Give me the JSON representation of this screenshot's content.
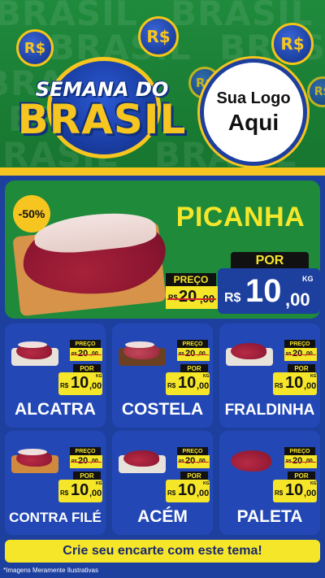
{
  "header": {
    "bg_word": "BRASIL",
    "currency_coin": "R$",
    "badge_line1": "SEMANA DO",
    "badge_line2": "BRASIL",
    "logo_line1": "Sua Logo",
    "logo_line2": "Aqui"
  },
  "feature": {
    "discount": "-50%",
    "name": "PICANHA",
    "old_label": "PREÇO",
    "old_currency": "R$",
    "old_int": "20",
    "old_dec": ",00",
    "new_label": "POR",
    "new_currency": "R$",
    "new_int": "10",
    "new_dec": ",00",
    "unit": "KG"
  },
  "cards": [
    {
      "name": "ALCATRA",
      "old_label": "PREÇO",
      "old_currency": "R$",
      "old_int": "20",
      "old_dec": ",00",
      "new_label": "POR",
      "new_currency": "R$",
      "new_int": "10",
      "new_dec": ",00",
      "unit": "KG"
    },
    {
      "name": "COSTELA",
      "old_label": "PREÇO",
      "old_currency": "R$",
      "old_int": "20",
      "old_dec": ",00",
      "new_label": "POR",
      "new_currency": "R$",
      "new_int": "10",
      "new_dec": ",00",
      "unit": "KG"
    },
    {
      "name": "FRALDINHA",
      "old_label": "PREÇO",
      "old_currency": "R$",
      "old_int": "20",
      "old_dec": ",00",
      "new_label": "POR",
      "new_currency": "R$",
      "new_int": "10",
      "new_dec": ",00",
      "unit": "KG"
    },
    {
      "name": "CONTRA FILÉ",
      "old_label": "PREÇO",
      "old_currency": "R$",
      "old_int": "20",
      "old_dec": ",00",
      "new_label": "POR",
      "new_currency": "R$",
      "new_int": "10",
      "new_dec": ",00",
      "unit": "KG"
    },
    {
      "name": "ACÉM",
      "old_label": "PREÇO",
      "old_currency": "R$",
      "old_int": "20",
      "old_dec": ",00",
      "new_label": "POR",
      "new_currency": "R$",
      "new_int": "10",
      "new_dec": ",00",
      "unit": "KG"
    },
    {
      "name": "PALETA",
      "old_label": "PREÇO",
      "old_currency": "R$",
      "old_int": "20",
      "old_dec": ",00",
      "new_label": "POR",
      "new_currency": "R$",
      "new_int": "10",
      "new_dec": ",00",
      "unit": "KG"
    }
  ],
  "footer": {
    "cta": "Crie seu encarte com este tema!",
    "disclaimer": "*Imagens Meramente Ilustrativas"
  },
  "colors": {
    "green": "#1f8a3c",
    "blue": "#1d3f9e",
    "yellow": "#f6e62a",
    "gold": "#f6c520"
  }
}
